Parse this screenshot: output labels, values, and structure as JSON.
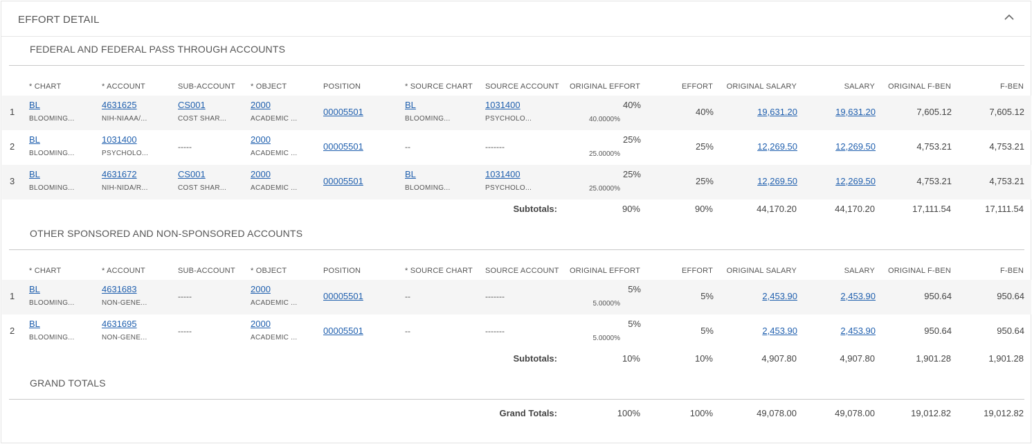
{
  "header": {
    "title": "EFFORT DETAIL"
  },
  "columns": {
    "chart": "* CHART",
    "account": "* ACCOUNT",
    "sub_account": "SUB-ACCOUNT",
    "object": "* OBJECT",
    "position": "POSITION",
    "source_chart": "* SOURCE CHART",
    "source_account": "SOURCE ACCOUNT",
    "original_effort": "ORIGINAL EFFORT",
    "effort": "EFFORT",
    "original_salary": "ORIGINAL SALARY",
    "salary": "SALARY",
    "original_fben": "ORIGINAL F-BEN",
    "fben": "F-BEN"
  },
  "federal": {
    "title": "FEDERAL AND FEDERAL PASS THROUGH ACCOUNTS",
    "rows": [
      {
        "num": "1",
        "chart": "BL",
        "chart_desc": "BLOOMING...",
        "account": "4631625",
        "account_desc": "NIH-NIAAA/...",
        "sub_account": "CS001",
        "sub_account_desc": "COST SHAR...",
        "object": "2000",
        "object_desc": "ACADEMIC ...",
        "position": "00005501",
        "source_chart": "BL",
        "source_chart_desc": "BLOOMING...",
        "source_account": "1031400",
        "source_account_desc": "PSYCHOLO...",
        "original_effort": "40%",
        "original_effort_precise": "40.0000%",
        "effort": "40%",
        "original_salary": "19,631.20",
        "salary": "19,631.20",
        "original_fben": "7,605.12",
        "fben": "7,605.12"
      },
      {
        "num": "2",
        "chart": "BL",
        "chart_desc": "BLOOMING...",
        "account": "1031400",
        "account_desc": "PSYCHOLO...",
        "sub_account": "-----",
        "sub_account_desc": "",
        "object": "2000",
        "object_desc": "ACADEMIC ...",
        "position": "00005501",
        "source_chart": "--",
        "source_chart_desc": "",
        "source_account": "-------",
        "source_account_desc": "",
        "original_effort": "25%",
        "original_effort_precise": "25.0000%",
        "effort": "25%",
        "original_salary": "12,269.50",
        "salary": "12,269.50",
        "original_fben": "4,753.21",
        "fben": "4,753.21"
      },
      {
        "num": "3",
        "chart": "BL",
        "chart_desc": "BLOOMING...",
        "account": "4631672",
        "account_desc": "NIH-NIDA/R...",
        "sub_account": "CS001",
        "sub_account_desc": "COST SHAR...",
        "object": "2000",
        "object_desc": "ACADEMIC ...",
        "position": "00005501",
        "source_chart": "BL",
        "source_chart_desc": "BLOOMING...",
        "source_account": "1031400",
        "source_account_desc": "PSYCHOLO...",
        "original_effort": "25%",
        "original_effort_precise": "25.0000%",
        "effort": "25%",
        "original_salary": "12,269.50",
        "salary": "12,269.50",
        "original_fben": "4,753.21",
        "fben": "4,753.21"
      }
    ],
    "subtotals": {
      "label": "Subtotals:",
      "original_effort": "90%",
      "effort": "90%",
      "original_salary": "44,170.20",
      "salary": "44,170.20",
      "original_fben": "17,111.54",
      "fben": "17,111.54"
    }
  },
  "other": {
    "title": "OTHER SPONSORED AND NON-SPONSORED ACCOUNTS",
    "rows": [
      {
        "num": "1",
        "chart": "BL",
        "chart_desc": "BLOOMING...",
        "account": "4631683",
        "account_desc": "NON-GENE...",
        "sub_account": "-----",
        "sub_account_desc": "",
        "object": "2000",
        "object_desc": "ACADEMIC ...",
        "position": "00005501",
        "source_chart": "--",
        "source_chart_desc": "",
        "source_account": "-------",
        "source_account_desc": "",
        "original_effort": "5%",
        "original_effort_precise": "5.0000%",
        "effort": "5%",
        "original_salary": "2,453.90",
        "salary": "2,453.90",
        "original_fben": "950.64",
        "fben": "950.64"
      },
      {
        "num": "2",
        "chart": "BL",
        "chart_desc": "BLOOMING...",
        "account": "4631695",
        "account_desc": "NON-GENE...",
        "sub_account": "-----",
        "sub_account_desc": "",
        "object": "2000",
        "object_desc": "ACADEMIC ...",
        "position": "00005501",
        "source_chart": "--",
        "source_chart_desc": "",
        "source_account": "-------",
        "source_account_desc": "",
        "original_effort": "5%",
        "original_effort_precise": "5.0000%",
        "effort": "5%",
        "original_salary": "2,453.90",
        "salary": "2,453.90",
        "original_fben": "950.64",
        "fben": "950.64"
      }
    ],
    "subtotals": {
      "label": "Subtotals:",
      "original_effort": "10%",
      "effort": "10%",
      "original_salary": "4,907.80",
      "salary": "4,907.80",
      "original_fben": "1,901.28",
      "fben": "1,901.28"
    }
  },
  "grand": {
    "title": "GRAND TOTALS",
    "label": "Grand Totals:",
    "original_effort": "100%",
    "effort": "100%",
    "original_salary": "49,078.00",
    "salary": "49,078.00",
    "original_fben": "19,012.82",
    "fben": "19,012.82"
  },
  "colors": {
    "link": "#1f5fae",
    "row_shade": "#f5f5f5",
    "border": "#e2e2e2"
  },
  "icons": {
    "collapse": "chevron-up-icon"
  }
}
